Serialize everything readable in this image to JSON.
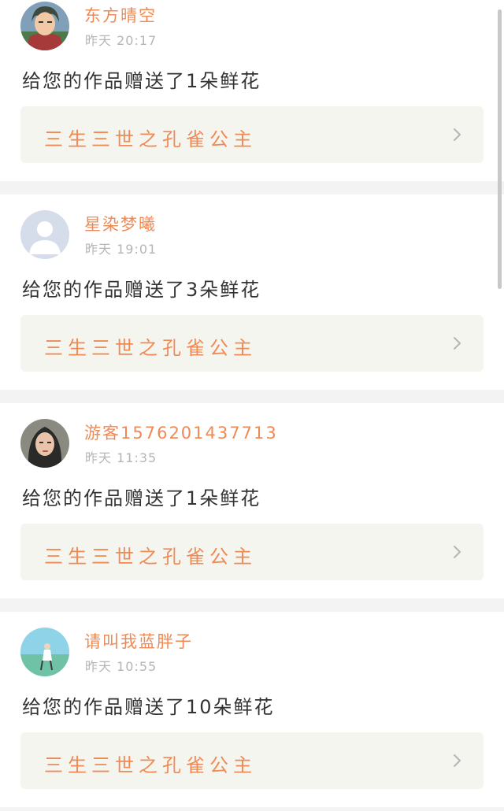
{
  "icons": {
    "work_link": "chevron-right-icon"
  },
  "colors": {
    "accent": "#ef8a55",
    "page_bg": "#f3f3f3",
    "card_bg": "#ffffff",
    "link_bg": "#f5f5f0",
    "time": "#b5b5b5",
    "chevron": "#b8b8b8"
  },
  "notifications": [
    {
      "username": "东方晴空",
      "time": "昨天 20:17",
      "message": "给您的作品赠送了1朵鲜花",
      "work_title": "三生三世之孔雀公主",
      "avatar": "anime-character-avatar"
    },
    {
      "username": "星染梦曦",
      "time": "昨天 19:01",
      "message": "给您的作品赠送了3朵鲜花",
      "work_title": "三生三世之孔雀公主",
      "avatar": "default-user-avatar"
    },
    {
      "username": "游客1576201437713",
      "time": "昨天 11:35",
      "message": "给您的作品赠送了1朵鲜花",
      "work_title": "三生三世之孔雀公主",
      "avatar": "woman-portrait-avatar"
    },
    {
      "username": "请叫我蓝胖子",
      "time": "昨天 10:55",
      "message": "给您的作品赠送了10朵鲜花",
      "work_title": "三生三世之孔雀公主",
      "avatar": "sky-figure-avatar"
    }
  ]
}
